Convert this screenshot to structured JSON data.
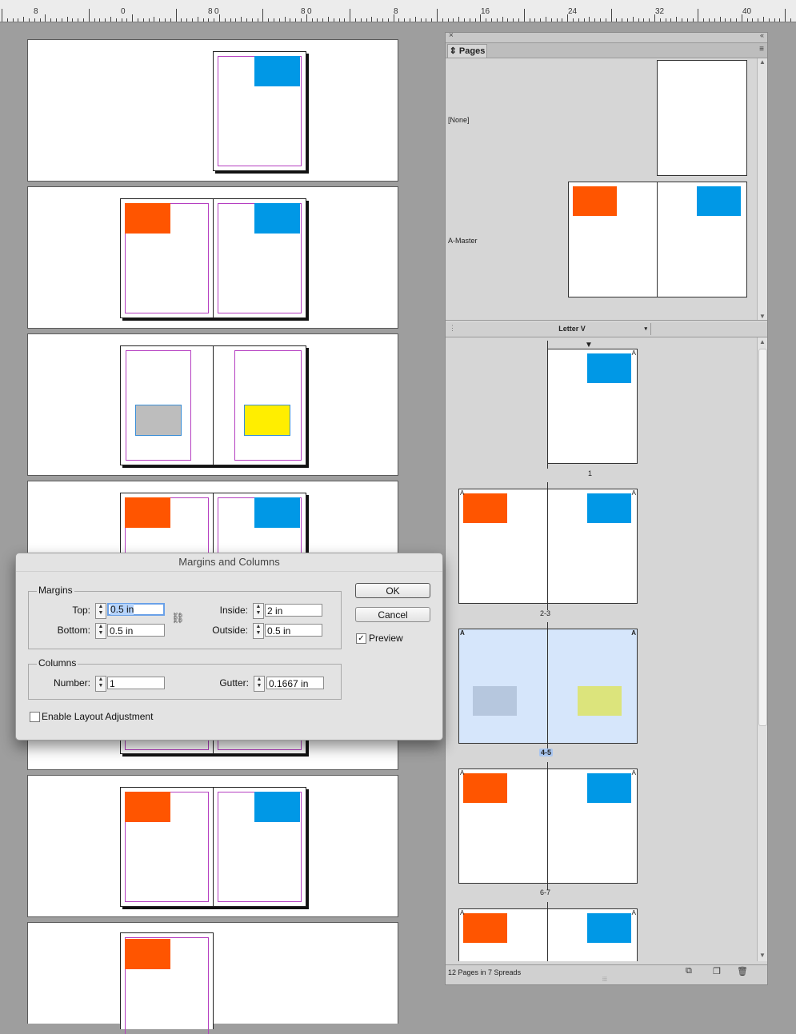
{
  "ruler": {
    "labels": [
      "8",
      "0",
      "8",
      "0",
      "8",
      "0",
      "8",
      "16",
      "24",
      "32",
      "40"
    ]
  },
  "pages_panel": {
    "tab_label": "Pages",
    "masters": [
      "[None]",
      "A-Master"
    ],
    "page_size": "Letter V",
    "spread_labels": [
      "1",
      "2-3",
      "4-5",
      "6-7"
    ],
    "master_letter": "A",
    "footer_text": "12 Pages in 7 Spreads"
  },
  "dialog": {
    "title": "Margins and Columns",
    "margins_label": "Margins",
    "top_label": "Top:",
    "top_value": "0.5 in",
    "bottom_label": "Bottom:",
    "bottom_value": "0.5 in",
    "inside_label": "Inside:",
    "inside_value": "2 in",
    "outside_label": "Outside:",
    "outside_value": "0.5 in",
    "columns_label": "Columns",
    "number_label": "Number:",
    "number_value": "1",
    "gutter_label": "Gutter:",
    "gutter_value": "0.1667 in",
    "enable_label": "Enable Layout Adjustment",
    "ok_label": "OK",
    "cancel_label": "Cancel",
    "preview_label": "Preview",
    "preview_checked": true,
    "enable_checked": false
  },
  "colors": {
    "orange": "#ff5500",
    "blue": "#0098e6",
    "yellow": "#ffee00",
    "gray": "#bdbdbd",
    "margin_guide": "#b53fc1",
    "selection": "#d6e6fb"
  }
}
